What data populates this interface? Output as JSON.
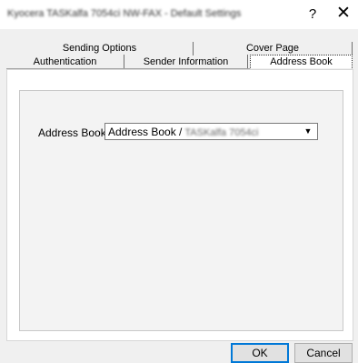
{
  "window": {
    "title": "Kyocera TASKalfa 7054ci NW-FAX - Default Settings",
    "help_label": "?",
    "close_label": "✕"
  },
  "tabs": {
    "row_back": [
      "Sending Options",
      "Cover Page"
    ],
    "row_front": [
      "Authentication",
      "Sender Information",
      "Address Book"
    ],
    "selected": "Address Book"
  },
  "address_book": {
    "label": "Address Book:",
    "value_prefix": "Address Book /",
    "value_device": "TASKalfa 7054ci"
  },
  "buttons": {
    "ok": "OK",
    "cancel": "Cancel"
  }
}
